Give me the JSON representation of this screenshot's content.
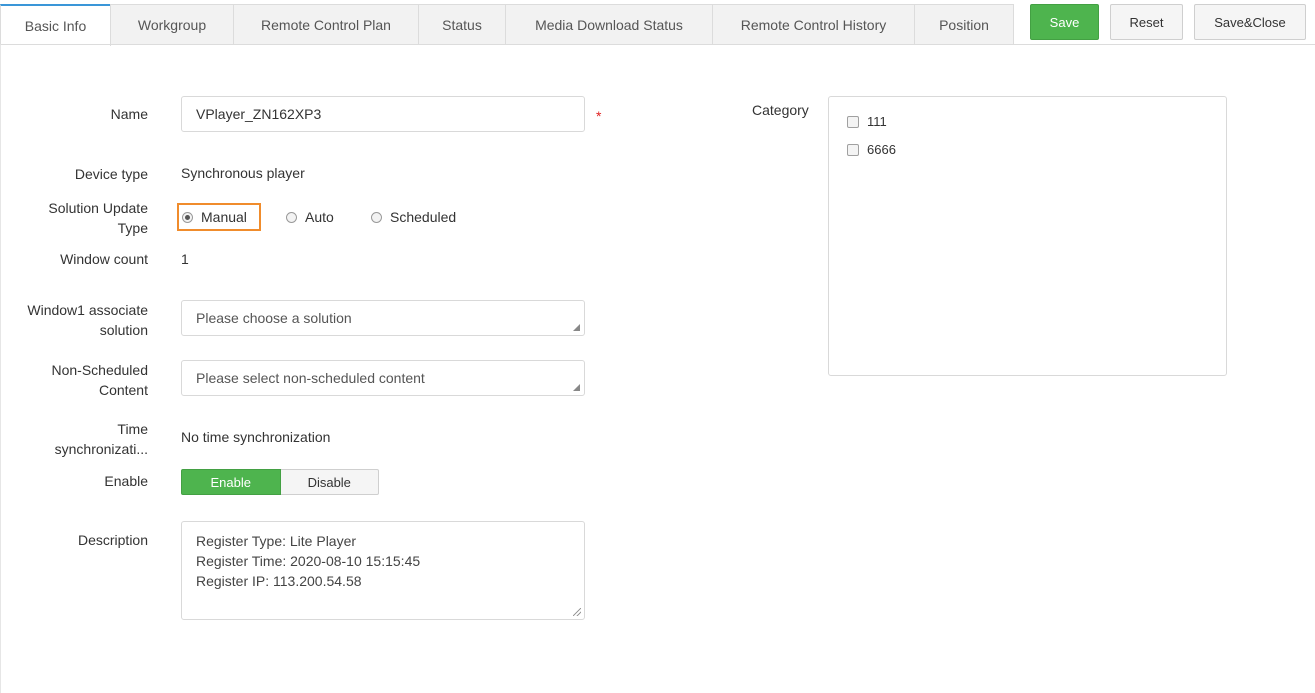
{
  "tabs": [
    "Basic Info",
    "Workgroup",
    "Remote Control Plan",
    "Status",
    "Media Download Status",
    "Remote Control History",
    "Position"
  ],
  "toolbar": {
    "save": "Save",
    "reset": "Reset",
    "save_close": "Save&Close"
  },
  "form": {
    "name_label": "Name",
    "name_value": "VPlayer_ZN162XP3",
    "required_mark": "*",
    "device_type_label": "Device type",
    "device_type_value": "Synchronous player",
    "solution_update_label_1": "Solution Update",
    "solution_update_label_2": "Type",
    "radio_options": [
      "Manual",
      "Auto",
      "Scheduled"
    ],
    "radio_selected": "Manual",
    "window_count_label": "Window count",
    "window_count_value": "1",
    "window1_label_1": "Window1 associate",
    "window1_label_2": "solution",
    "window1_placeholder": "Please choose a solution",
    "nonsched_label_1": "Non-Scheduled",
    "nonsched_label_2": "Content",
    "nonsched_placeholder": "Please select non-scheduled content",
    "timesync_label_1": "Time",
    "timesync_label_2": "synchronizati...",
    "timesync_value": "No time synchronization",
    "enable_label": "Enable",
    "enable_on": "Enable",
    "enable_off": "Disable",
    "description_label": "Description",
    "description_lines": [
      "Register Type: Lite Player",
      "Register Time: 2020-08-10 15:15:45",
      "Register IP: 113.200.54.58"
    ]
  },
  "category": {
    "label": "Category",
    "items": [
      "111",
      "6666"
    ]
  },
  "colors": {
    "accent_green": "#4eb44e",
    "tab_active_border": "#3a96d8",
    "focus_orange": "#f08c2c",
    "required_red": "#e02020"
  }
}
